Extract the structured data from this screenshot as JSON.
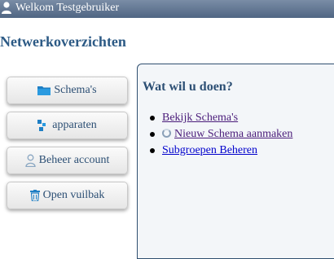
{
  "header": {
    "welcome_text": "Welkom Testgebruiker",
    "user_icon": "user-icon"
  },
  "page": {
    "title": "Netwerkoverzichten"
  },
  "sidebar": {
    "buttons": [
      {
        "label": "Schema's",
        "icon": "folder-icon"
      },
      {
        "label": "apparaten",
        "icon": "devices-icon"
      },
      {
        "label": "Beheer account",
        "icon": "user-icon"
      },
      {
        "label": "Open vuilbak",
        "icon": "trash-icon"
      }
    ]
  },
  "actions": {
    "title": "Wat wil u doen?",
    "items": [
      {
        "label": "Bekijk Schema's",
        "visited": true
      },
      {
        "label": "Nieuw Schema aanmaken",
        "visited": true,
        "icon": "loading-icon"
      },
      {
        "label": "Subgroepen Beheren",
        "visited": false
      }
    ]
  },
  "colors": {
    "accent": "#2c5a85",
    "header_bar": "#5a6f8c",
    "visited_link": "#4a1c7a",
    "link": "#0000cc"
  }
}
